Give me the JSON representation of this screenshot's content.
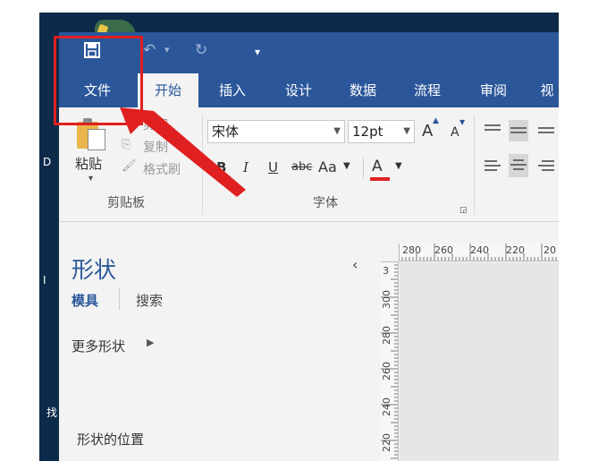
{
  "tabs": [
    {
      "label": "文件"
    },
    {
      "label": "开始"
    },
    {
      "label": "插入"
    },
    {
      "label": "设计"
    },
    {
      "label": "数据"
    },
    {
      "label": "流程"
    },
    {
      "label": "审阅"
    },
    {
      "label": "视"
    }
  ],
  "ribbon": {
    "clipboard": {
      "paste": "粘贴",
      "cut": "剪切",
      "copy": "复制",
      "format_painter": "格式刷",
      "group": "剪贴板"
    },
    "font": {
      "family": "宋体",
      "size": "12pt",
      "bold": "B",
      "italic": "I",
      "underline": "U",
      "strike": "abc",
      "case": "Aa",
      "color": "A",
      "grow": "A",
      "shrink": "A",
      "group": "字体"
    }
  },
  "shapes_pane": {
    "title": "形状",
    "tab_stencil": "模具",
    "tab_search": "搜索",
    "more_shapes": "更多形状",
    "shape_position": "形状的位置"
  },
  "ruler": {
    "h_labels": [
      "280",
      "260",
      "240",
      "220",
      "20"
    ],
    "v_labels": [
      "300",
      "280",
      "260",
      "240",
      "220"
    ],
    "v_top": "3"
  },
  "desktop": {
    "m1": "D",
    "m2": "I",
    "m3": "找"
  },
  "colors": {
    "accent": "#2b579a",
    "annotation": "#e02020",
    "font_color": "#e02020"
  },
  "icons": {
    "save": "save-icon",
    "undo": "undo-icon",
    "redo": "redo-icon",
    "collapse": "chevron-left-icon"
  }
}
